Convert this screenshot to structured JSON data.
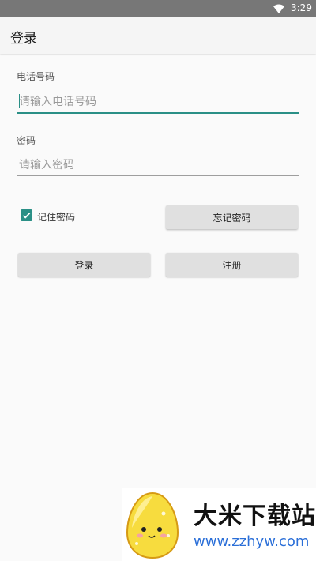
{
  "status_bar": {
    "time": "3:29",
    "wifi_icon": "wifi-icon"
  },
  "app_bar": {
    "title": "登录"
  },
  "form": {
    "phone_label": "电话号码",
    "phone_placeholder": "请输入电话号码",
    "phone_value": "",
    "password_label": "密码",
    "password_placeholder": "请输入密码",
    "password_value": "",
    "remember_label": "记住密码",
    "remember_checked": true,
    "forgot_button": "忘记密码",
    "login_button": "登录",
    "register_button": "注册"
  },
  "watermark": {
    "title": "大米下载站",
    "url": "www.zzhyw.com",
    "mascot_icon": "egg-mascot-logo"
  },
  "colors": {
    "accent": "#2a8f86",
    "status_bar": "#777777",
    "button": "#e0e0e0",
    "watermark_url": "#2b6fd8"
  }
}
